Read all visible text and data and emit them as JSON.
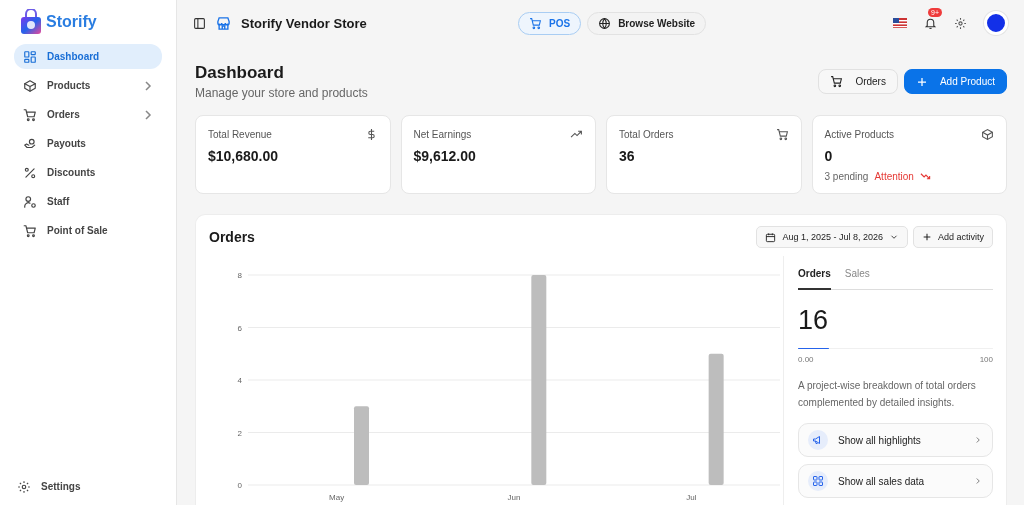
{
  "brand": {
    "name": "Storify"
  },
  "sidebar": {
    "items": [
      {
        "label": "Dashboard",
        "kind": "link",
        "selected": true
      },
      {
        "label": "Products",
        "kind": "group",
        "selected": false
      },
      {
        "label": "Orders",
        "kind": "group",
        "selected": false
      },
      {
        "label": "Payouts",
        "kind": "link",
        "selected": false
      },
      {
        "label": "Discounts",
        "kind": "link",
        "selected": false
      },
      {
        "label": "Staff",
        "kind": "link",
        "selected": false
      },
      {
        "label": "Point of Sale",
        "kind": "link",
        "selected": false
      }
    ],
    "footer": {
      "label": "Settings"
    }
  },
  "topbar": {
    "store_name": "Storify Vendor Store",
    "pos_button": "POS",
    "browse_button": "Browse Website",
    "notification_badge": "9+"
  },
  "page": {
    "title": "Dashboard",
    "subtitle": "Manage your store and products",
    "buttons": [
      {
        "label": "Orders",
        "kind": "secondary"
      },
      {
        "label": "Add Product",
        "kind": "primary"
      }
    ]
  },
  "stats": [
    {
      "label": "Total Revenue",
      "value": "$10,680.00"
    },
    {
      "label": "Net Earnings",
      "value": "$9,612.00"
    },
    {
      "label": "Total Orders",
      "value": "36"
    },
    {
      "label": "Active Products",
      "value": "0",
      "note": "3 pending",
      "alert": "Attention"
    }
  ],
  "orders_panel": {
    "title": "Orders",
    "date_range": "Aug 1, 2025 - Jul 8, 2026",
    "add_button": "Add activity",
    "chart_data": {
      "type": "bar",
      "categories": [
        "May",
        "Jun",
        "Jul"
      ],
      "series": [
        {
          "color": "#bdbdbd",
          "values": [
            3,
            8,
            5
          ]
        }
      ],
      "grid": true,
      "ylim": [
        0,
        8
      ],
      "yticks": [
        0,
        2,
        4,
        6,
        8
      ]
    },
    "tabs": [
      {
        "label": "Orders",
        "selected": true
      },
      {
        "label": "Sales",
        "selected": false
      }
    ],
    "big_value": "16",
    "progress": {
      "level": 0.16,
      "min_label": "0.00",
      "max_label": "100"
    },
    "description": "A project-wise breakdown of total orders complemented by detailed insights.",
    "links": [
      "Show all highlights",
      "Show all sales data"
    ]
  }
}
